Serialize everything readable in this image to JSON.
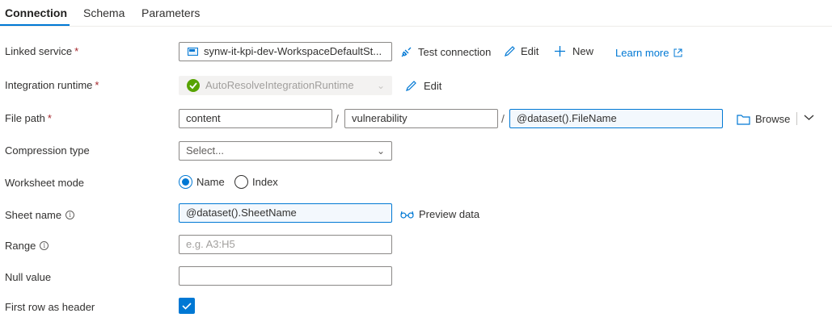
{
  "tabs": [
    {
      "label": "Connection"
    },
    {
      "label": "Schema"
    },
    {
      "label": "Parameters"
    }
  ],
  "linked_service": {
    "label": "Linked service",
    "value": "synw-it-kpi-dev-WorkspaceDefaultSt...",
    "test_connection": "Test connection",
    "edit": "Edit",
    "new": "New",
    "learn_more": "Learn more"
  },
  "integration_runtime": {
    "label": "Integration runtime",
    "value": "AutoResolveIntegrationRuntime",
    "edit": "Edit"
  },
  "file_path": {
    "label": "File path",
    "container": "content",
    "directory": "vulnerability",
    "file": "@dataset().FileName",
    "separator": "/",
    "browse": "Browse"
  },
  "compression": {
    "label": "Compression type",
    "placeholder": "Select..."
  },
  "worksheet_mode": {
    "label": "Worksheet mode",
    "options": [
      "Name",
      "Index"
    ],
    "selected": "Name"
  },
  "sheet_name": {
    "label": "Sheet name",
    "value": "@dataset().SheetName",
    "preview": "Preview data"
  },
  "range": {
    "label": "Range",
    "placeholder": "e.g. A3:H5"
  },
  "null_value": {
    "label": "Null value",
    "value": ""
  },
  "first_row_header": {
    "label": "First row as header",
    "checked": true
  },
  "colors": {
    "accent": "#0078d4",
    "required": "#a4262c",
    "success": "#107c10"
  }
}
